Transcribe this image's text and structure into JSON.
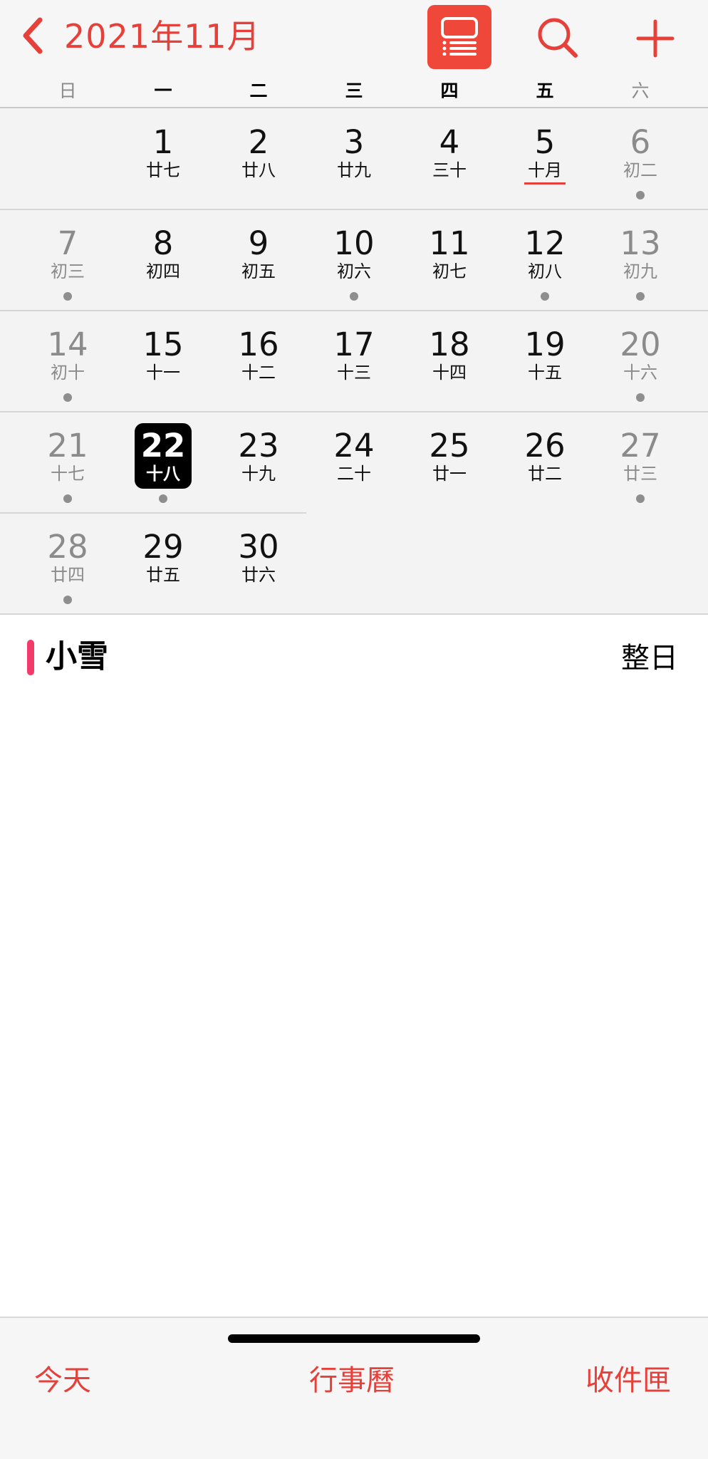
{
  "header": {
    "month_title": "2021年11月",
    "back_icon": "chevron-left-icon",
    "list_icon": "list-view-icon",
    "search_icon": "search-icon",
    "add_icon": "plus-icon",
    "accent_color": "#e5413a"
  },
  "weekdays": [
    "日",
    "一",
    "二",
    "三",
    "四",
    "五",
    "六"
  ],
  "weeks": [
    [
      null,
      {
        "day": "1",
        "lunar": "廿七"
      },
      {
        "day": "2",
        "lunar": "廿八"
      },
      {
        "day": "3",
        "lunar": "廿九"
      },
      {
        "day": "4",
        "lunar": "三十"
      },
      {
        "day": "5",
        "lunar": "十月",
        "lunar_month_start": true
      },
      {
        "day": "6",
        "lunar": "初二",
        "has_event": true
      }
    ],
    [
      {
        "day": "7",
        "lunar": "初三",
        "has_event": true
      },
      {
        "day": "8",
        "lunar": "初四"
      },
      {
        "day": "9",
        "lunar": "初五"
      },
      {
        "day": "10",
        "lunar": "初六",
        "has_event": true
      },
      {
        "day": "11",
        "lunar": "初七"
      },
      {
        "day": "12",
        "lunar": "初八",
        "has_event": true
      },
      {
        "day": "13",
        "lunar": "初九",
        "has_event": true
      }
    ],
    [
      {
        "day": "14",
        "lunar": "初十",
        "has_event": true
      },
      {
        "day": "15",
        "lunar": "十一"
      },
      {
        "day": "16",
        "lunar": "十二"
      },
      {
        "day": "17",
        "lunar": "十三"
      },
      {
        "day": "18",
        "lunar": "十四"
      },
      {
        "day": "19",
        "lunar": "十五"
      },
      {
        "day": "20",
        "lunar": "十六",
        "has_event": true
      }
    ],
    [
      {
        "day": "21",
        "lunar": "十七",
        "has_event": true
      },
      {
        "day": "22",
        "lunar": "十八",
        "has_event": true,
        "selected": true
      },
      {
        "day": "23",
        "lunar": "十九"
      },
      {
        "day": "24",
        "lunar": "二十"
      },
      {
        "day": "25",
        "lunar": "廿一"
      },
      {
        "day": "26",
        "lunar": "廿二"
      },
      {
        "day": "27",
        "lunar": "廿三",
        "has_event": true
      }
    ],
    [
      {
        "day": "28",
        "lunar": "廿四",
        "has_event": true
      },
      {
        "day": "29",
        "lunar": "廿五"
      },
      {
        "day": "30",
        "lunar": "廿六"
      },
      null,
      null,
      null,
      null
    ]
  ],
  "event": {
    "title": "小雪",
    "time": "整日",
    "color": "#f23b69"
  },
  "tabs": {
    "today": "今天",
    "calendars": "行事曆",
    "inbox": "收件匣"
  }
}
